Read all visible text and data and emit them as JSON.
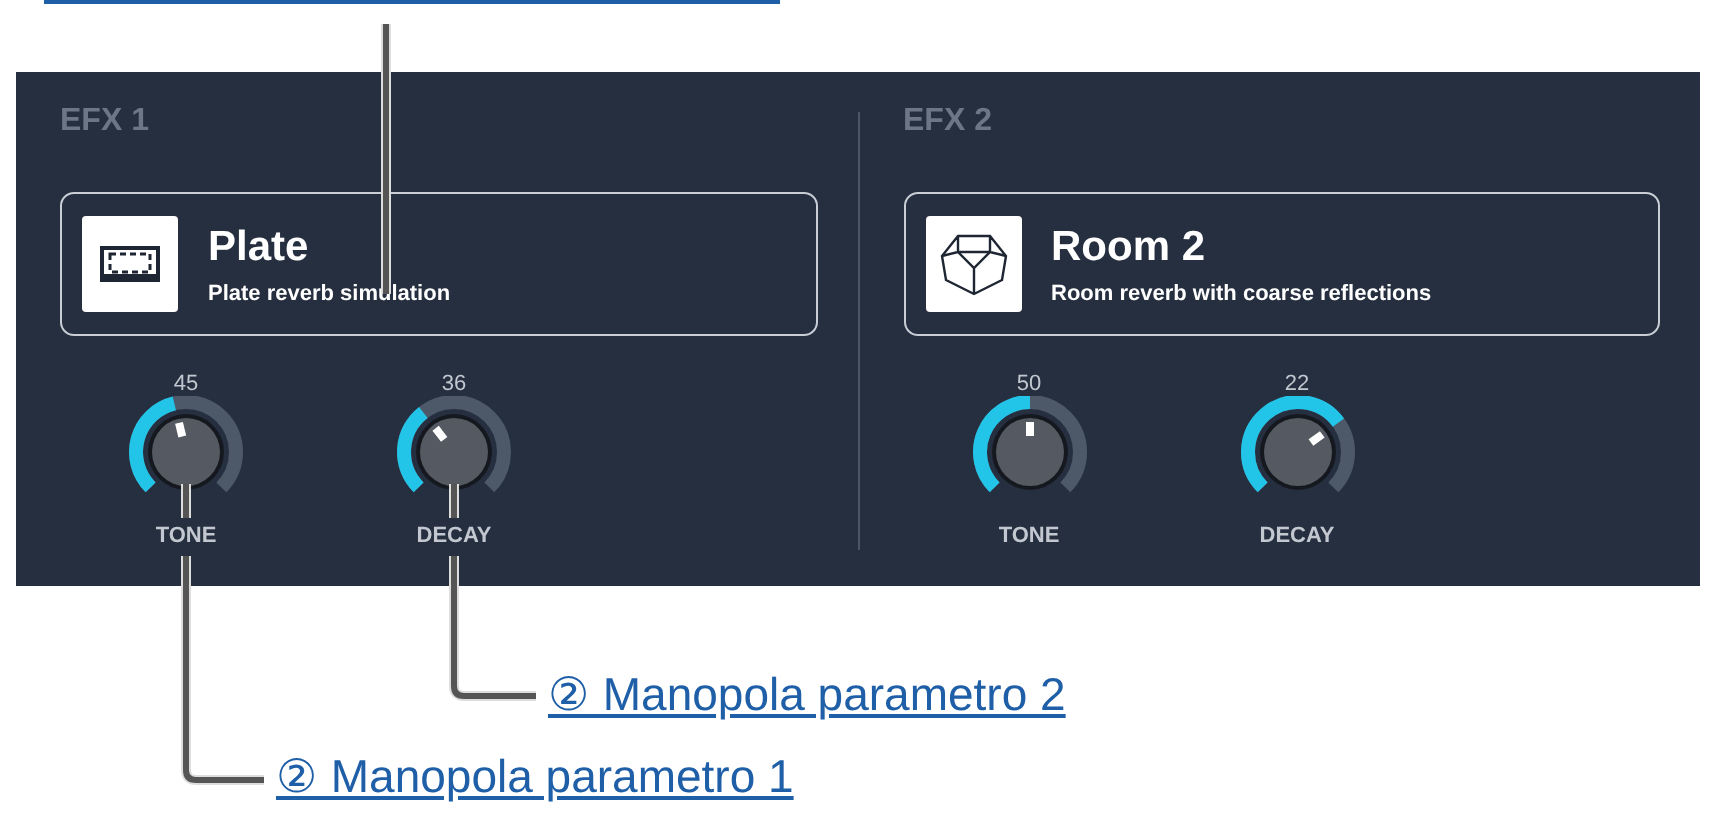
{
  "effects": [
    {
      "label": "EFX 1",
      "name": "Plate",
      "description": "Plate reverb simulation",
      "knobs": [
        {
          "value": "45",
          "label": "TONE"
        },
        {
          "value": "36",
          "label": "DECAY"
        }
      ]
    },
    {
      "label": "EFX 2",
      "name": "Room 2",
      "description": "Room reverb with coarse reflections",
      "knobs": [
        {
          "value": "50",
          "label": "TONE"
        },
        {
          "value": "22",
          "label": "DECAY"
        }
      ]
    }
  ],
  "callouts": [
    "② Manopola parametro 2",
    "② Manopola parametro 1"
  ]
}
